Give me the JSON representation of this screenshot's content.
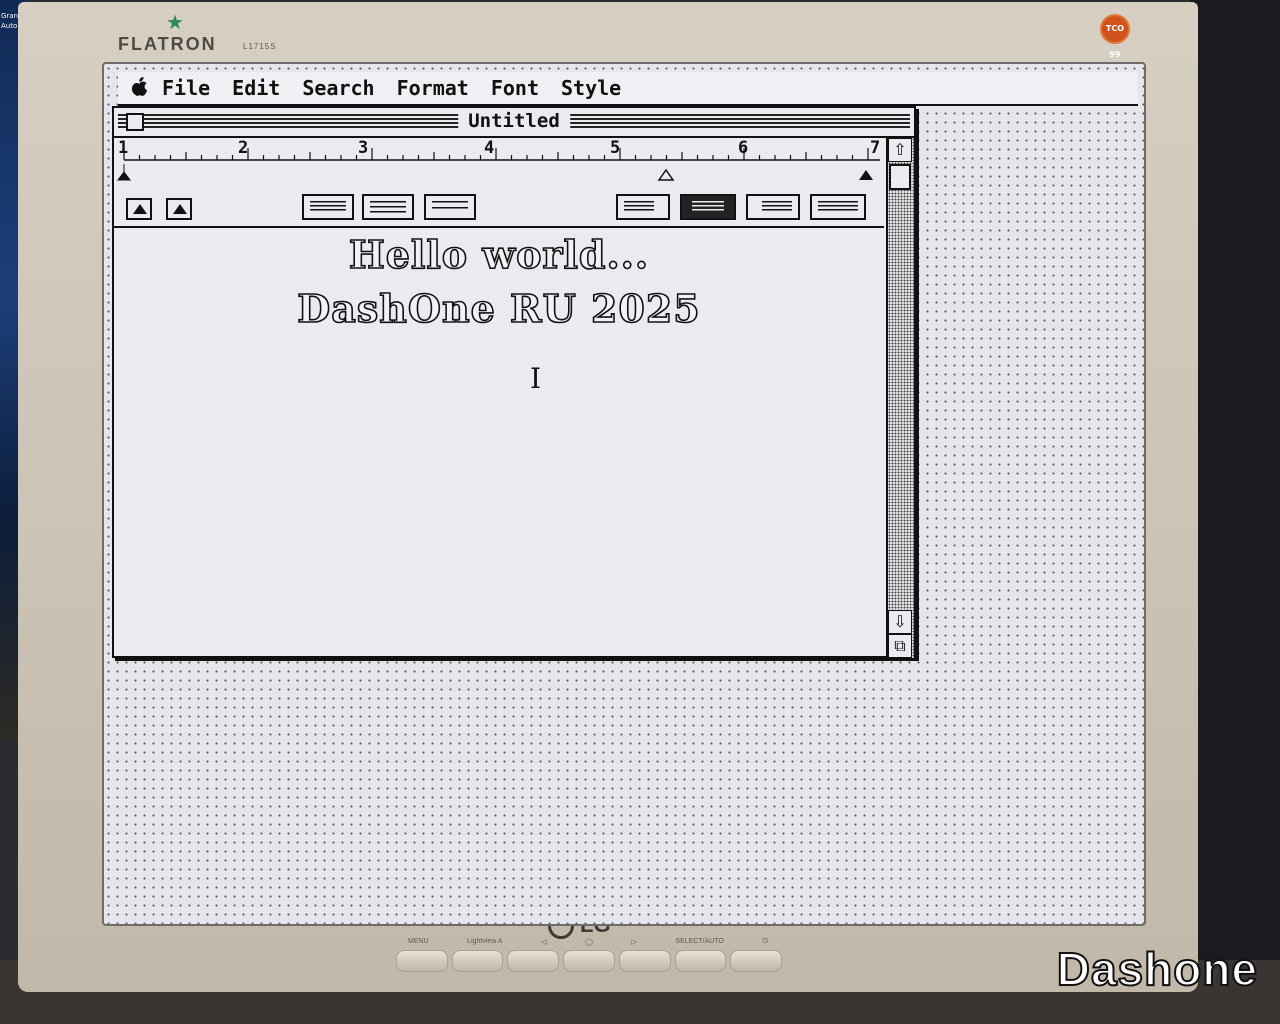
{
  "left_desktop": {
    "labels": [
      "Grand",
      "Auto V"
    ]
  },
  "monitor": {
    "brand": "FLATRON",
    "model": "L1715S",
    "logo": "LG",
    "badge": "TCO 99",
    "controls": [
      "MENU",
      "Lightview A",
      "◁",
      "◯",
      "▷",
      "SELECT/AUTO",
      "⏻"
    ]
  },
  "menubar": {
    "apple_icon": "",
    "items": [
      "File",
      "Edit",
      "Search",
      "Format",
      "Font",
      "Style"
    ]
  },
  "window": {
    "title": "Untitled",
    "ruler_numbers": [
      "1",
      "2",
      "3",
      "4",
      "5",
      "6",
      "7"
    ],
    "document_lines": [
      "Hello world...",
      "DashOne RU 2025"
    ]
  },
  "scrollbar": {
    "up_arrow": "⇧",
    "down_arrow": "⇩",
    "grow_icon": "⧉"
  },
  "watermark": "Dashone"
}
